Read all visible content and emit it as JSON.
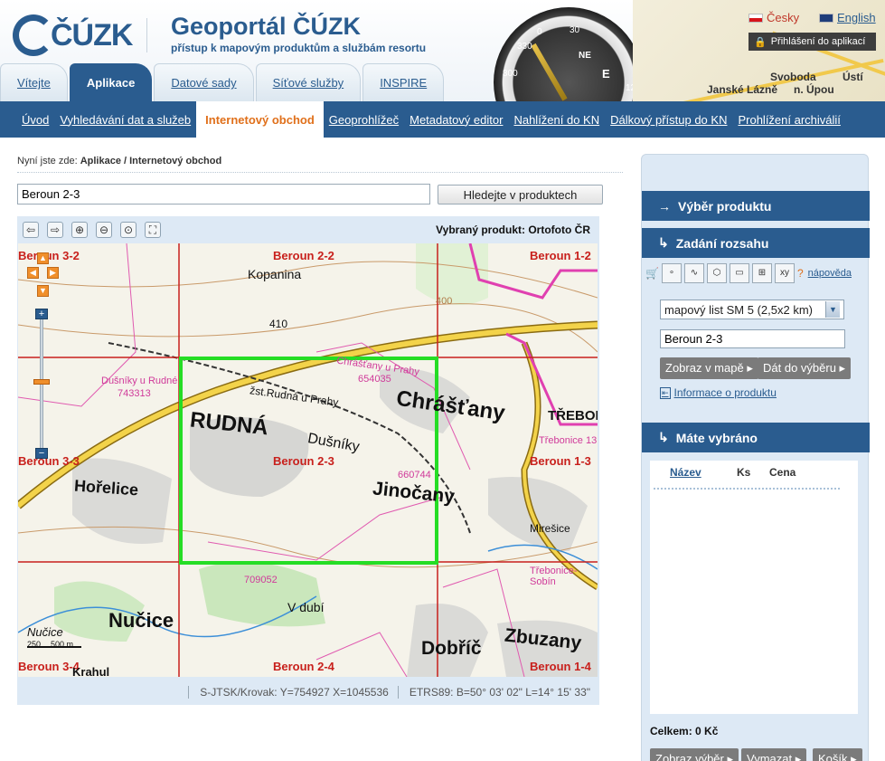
{
  "header": {
    "logo_text": "ČÚZK",
    "title": "Geoportál ČÚZK",
    "subtitle": "přístup k mapovým produktům a službám resortu",
    "lang_cz": "Česky",
    "lang_en": "English",
    "login": "Přihlášení do aplikací",
    "topmap_labels": [
      "Svoboda",
      "Ústí",
      "Janské Lázně",
      "n. Úpou"
    ],
    "compass_labels": [
      "NE",
      "E",
      "330",
      "300",
      "0",
      "30",
      "120"
    ]
  },
  "tabs": [
    "Vítejte",
    "Aplikace",
    "Datové sady",
    "Síťové služby",
    "INSPIRE"
  ],
  "subnav": [
    "Úvod",
    "Vyhledávání dat a služeb",
    "Internetový obchod",
    "Geoprohlížeč",
    "Metadatový editor",
    "Nahlížení do KN",
    "Dálkový přístup do KN",
    "Prohlížení archiválií"
  ],
  "breadcrumb": {
    "prefix": "Nyní jste zde:",
    "path": "Aplikace / Internetový obchod"
  },
  "search": {
    "value": "Beroun 2-3",
    "button": "Hledejte v produktech"
  },
  "map": {
    "selected_product": "Vybraný produkt: Ortofoto ČR",
    "sheets": [
      "Beroun 3-2",
      "Beroun 2-2",
      "Beroun 1-2",
      "Beroun 3-3",
      "Beroun 2-3",
      "Beroun 1-3",
      "Beroun 3-4",
      "Beroun 2-4",
      "Beroun 1-4"
    ],
    "places": {
      "kopanina": "Kopanina",
      "rudna": "RUDNÁ",
      "chrastany": "Chrášťany",
      "dusniky": "Dušníky",
      "jinocany": "Jinočany",
      "horelice": "Hořelice",
      "nucice": "Nučice",
      "trebonice": "TŘEBONIC",
      "mirosice": "Mirešice",
      "dobric": "Dobříč",
      "zbuzany": "Zbuzany",
      "vdubi": "V dubí",
      "zst": "žst.Rudná u Prahy",
      "nucice_small": "Nučice",
      "krahul": "Krahul",
      "elev410": "410",
      "elev400": "400"
    },
    "cadastral": [
      "Dušníky u Rudné",
      "743313",
      "Chrášťany u Prahy",
      "654035",
      "660744",
      "Třebonice 13",
      "Třebonice-Sobín",
      "709052"
    ],
    "scale": [
      "250",
      "500 m"
    ],
    "status_sjtsk": "S-JTSK/Krovak: Y=754927 X=1045536",
    "status_etrs": "ETRS89: B=50° 03' 02\" L=14° 15' 33\""
  },
  "sidebar": {
    "head1": "Výběr produktu",
    "head2": "Zadání rozsahu",
    "help": "nápověda",
    "select_value": "mapový list SM 5 (2,5x2 km)",
    "sheet_value": "Beroun 2-3",
    "btn_show": "Zobraz v mapě",
    "btn_add": "Dát do výběru",
    "info_link": "Informace o produktu",
    "head3": "Máte vybráno",
    "col_name": "Název",
    "col_qty": "Ks",
    "col_price": "Cena",
    "total": "Celkem: 0 Kč",
    "btn_show_sel": "Zobraz výběr",
    "btn_clear": "Vymazat",
    "btn_cart": "Košík"
  }
}
